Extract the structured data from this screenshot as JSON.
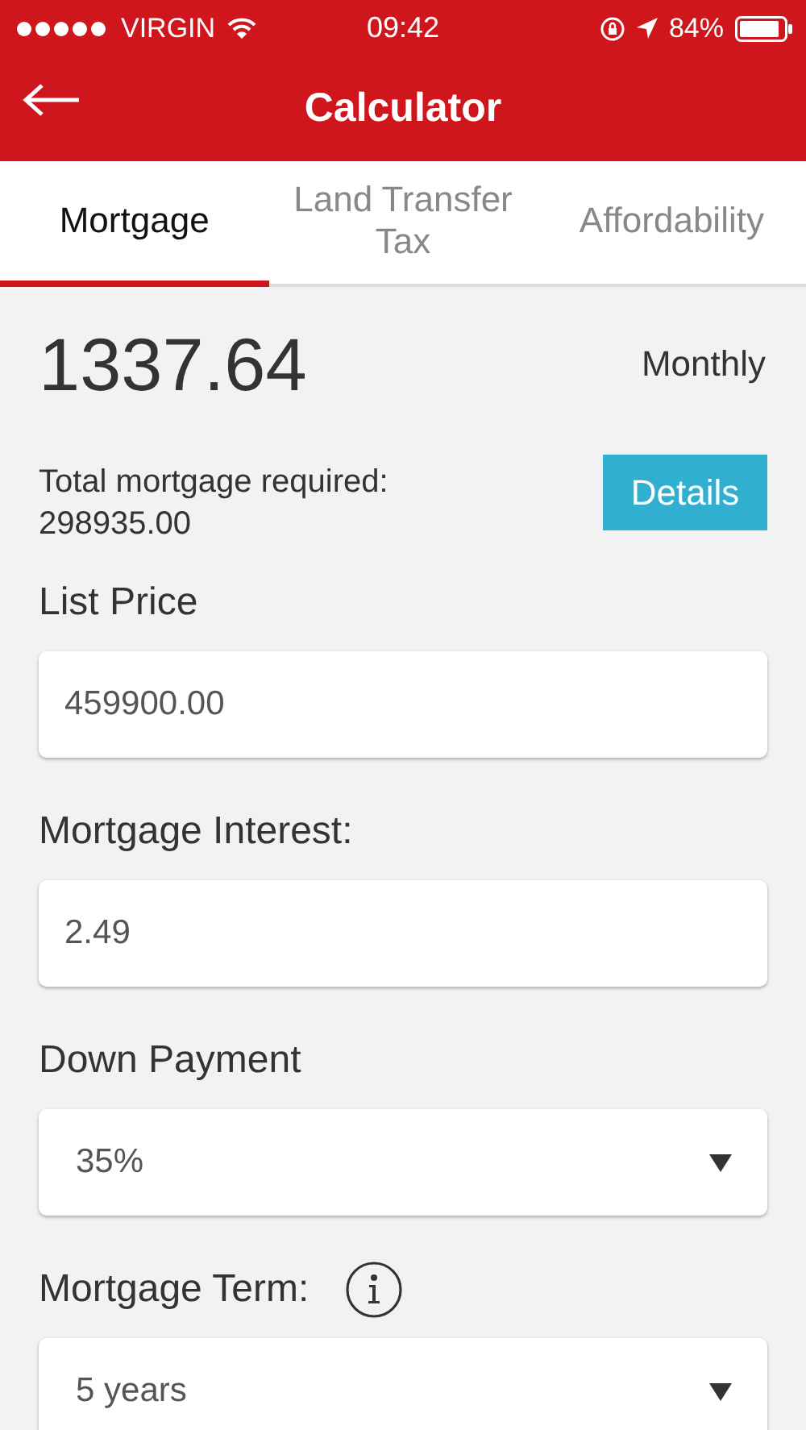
{
  "status_bar": {
    "carrier": "VIRGIN",
    "time": "09:42",
    "battery": "84%"
  },
  "header": {
    "title": "Calculator"
  },
  "tabs": [
    {
      "label": "Mortgage",
      "selected": true
    },
    {
      "label": "Land Transfer Tax",
      "selected": false
    },
    {
      "label": "Affordability",
      "selected": false
    }
  ],
  "result": {
    "amount": "1337.64",
    "period": "Monthly",
    "total_label": "Total mortgage required:",
    "total_value": "298935.00",
    "details_button": "Details"
  },
  "fields": [
    {
      "label": "List Price",
      "kind": "input",
      "value": "459900.00",
      "has_info": false
    },
    {
      "label": "Mortgage Interest:",
      "kind": "input",
      "value": "2.49",
      "has_info": false
    },
    {
      "label": "Down Payment",
      "kind": "select",
      "value": "35%",
      "has_info": false
    },
    {
      "label": "Mortgage Term:",
      "kind": "select",
      "value": "5 years",
      "has_info": true
    }
  ]
}
